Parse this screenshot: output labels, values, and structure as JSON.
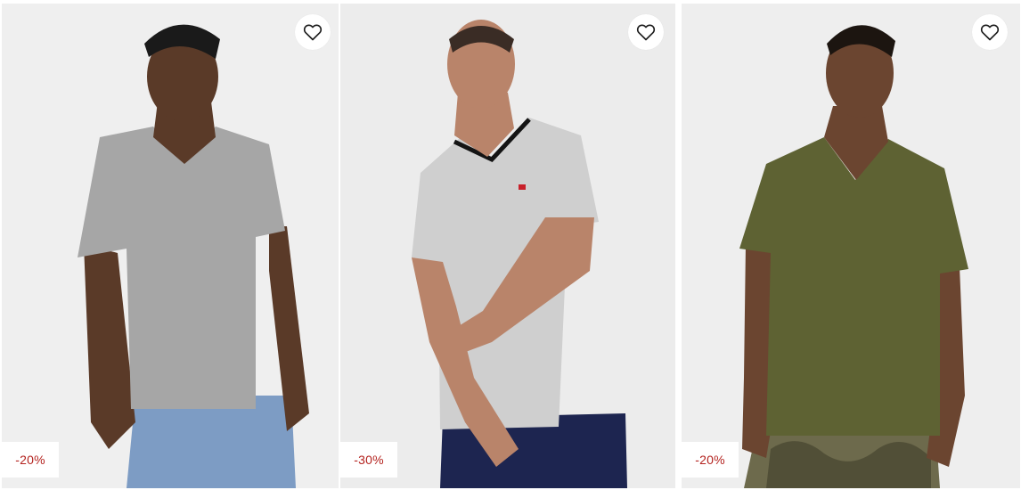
{
  "products": [
    {
      "discount": "-20%",
      "favorite_icon": "heart-outline-icon",
      "shirt_color": "#a6a6a6",
      "pants_color": "#7d9cc4",
      "skin_color": "#5a3a28",
      "bg_color": "#efefef"
    },
    {
      "discount": "-30%",
      "favorite_icon": "heart-outline-icon",
      "shirt_color": "#cfcfcf",
      "pants_color": "#1d2550",
      "skin_color": "#b9846a",
      "bg_color": "#ececec"
    },
    {
      "discount": "-20%",
      "favorite_icon": "heart-outline-icon",
      "shirt_color": "#5e6233",
      "pants_color": "#6d6a4c",
      "skin_color": "#6b4530",
      "bg_color": "#eeeeee"
    }
  ],
  "colors": {
    "discount_text": "#b4231f",
    "badge_bg": "#ffffff"
  }
}
